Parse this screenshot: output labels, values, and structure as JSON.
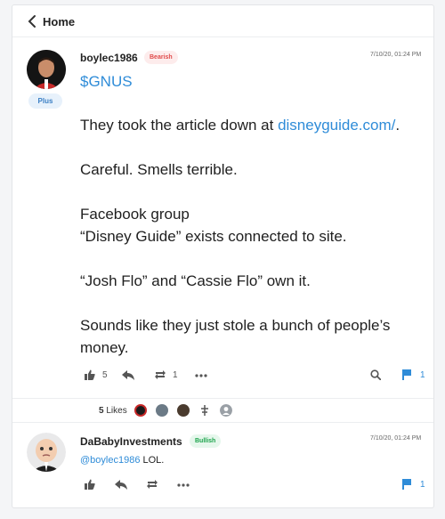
{
  "nav": {
    "back_label": "Home"
  },
  "post": {
    "username": "boylec1986",
    "sentiment": "Bearish",
    "membership": "Plus",
    "timestamp": "7/10/20, 01:24 PM",
    "ticker": "$GNUS",
    "line1_pre": "They took the article down at ",
    "line1_link": "disneyguide.com/",
    "line1_post": ".",
    "line2": "Careful. Smells terrible.",
    "line3a": "Facebook group",
    "line3b": "“Disney Guide” exists connected to site.",
    "line4": "“Josh Flo” and “Cassie Flo” own it.",
    "line5": "Sounds like they just stole a bunch of people’s money.",
    "actions": {
      "like_count": "5",
      "reshare_count": "1",
      "comment_count": "1"
    }
  },
  "likes": {
    "count": "5",
    "label": "Likes"
  },
  "reply": {
    "username": "DaBabyInvestments",
    "sentiment": "Bullish",
    "timestamp": "7/10/20, 01:24 PM",
    "mention": "@boylec1986",
    "text": " LOL.",
    "actions": {
      "comment_count": "1"
    }
  },
  "colors": {
    "accent": "#2f8cd8",
    "bearish": "#e04a4a",
    "bullish": "#1aa34a"
  }
}
